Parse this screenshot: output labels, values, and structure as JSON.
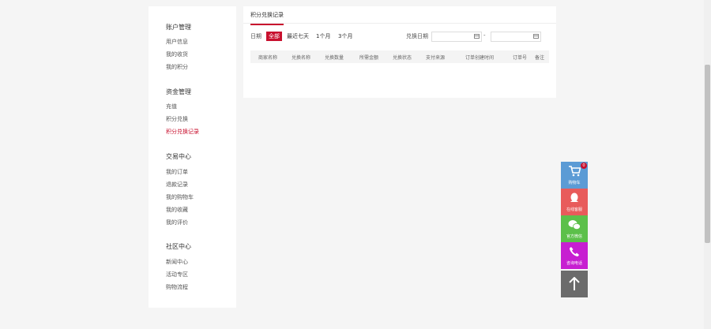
{
  "sidebar": {
    "sections": [
      {
        "title": "账户管理",
        "items": [
          "用户信息",
          "我的收货",
          "我的积分"
        ]
      },
      {
        "title": "资金管理",
        "items": [
          "充值",
          "积分兑换",
          "积分兑换记录"
        ]
      },
      {
        "title": "交易中心",
        "items": [
          "我的订单",
          "退款记录",
          "我的购物车",
          "我的收藏",
          "我的评价"
        ]
      },
      {
        "title": "社区中心",
        "items": [
          "新闻中心",
          "活动专区",
          "购物流程"
        ]
      }
    ],
    "active_item": "积分兑换记录"
  },
  "main": {
    "tab": "积分兑换记录",
    "filter": {
      "label": "日期",
      "options": [
        "全部",
        "最近七天",
        "1个月",
        "3个月"
      ],
      "selected": "全部",
      "range_label": "兑换日期",
      "range_separator": "-"
    },
    "table": {
      "columns": [
        "商家名称",
        "兑换名称",
        "兑换数量",
        "所需金额",
        "兑换状态",
        "支付来源",
        "订单创建时间",
        "订单号",
        "备注"
      ]
    }
  },
  "float_bar": {
    "items": [
      {
        "label": "购物车",
        "icon": "cart-icon",
        "color": "#5b9bd5",
        "badge": "0"
      },
      {
        "label": "在线客服",
        "icon": "qq-icon",
        "color": "#e85b5b"
      },
      {
        "label": "官方微信",
        "icon": "wechat-icon",
        "color": "#5cc04a"
      },
      {
        "label": "咨询电话",
        "icon": "phone-icon",
        "color": "#c71fd1"
      },
      {
        "label": "",
        "icon": "arrow-up-icon",
        "color": "#6b6b6b"
      }
    ]
  },
  "colors": {
    "accent": "#c8102e",
    "background": "#f5f5f5"
  }
}
